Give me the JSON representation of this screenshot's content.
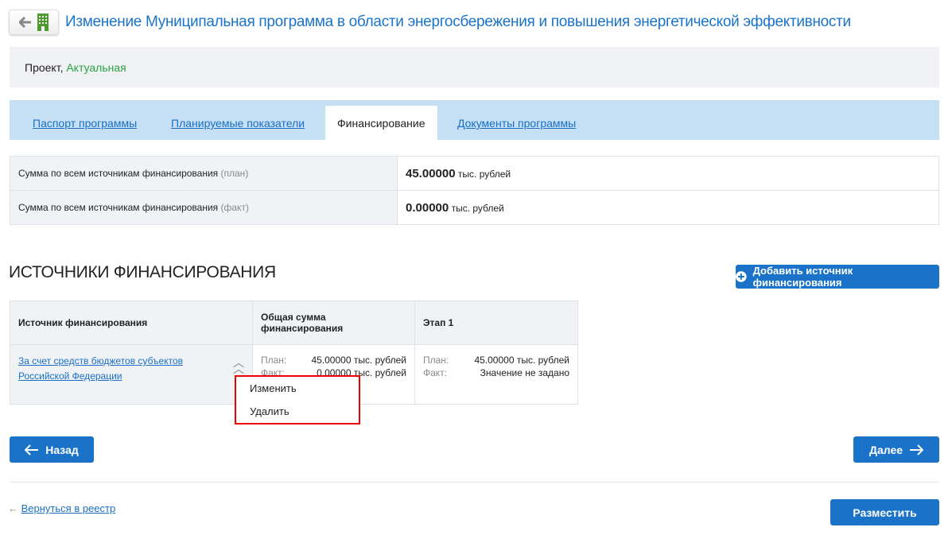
{
  "header": {
    "title": "Изменение Муниципальная программа в области энергосбережения и повышения энергетической эффективности"
  },
  "status": {
    "prefix": "Проект,",
    "state": "Актуальная"
  },
  "tabs": [
    {
      "label": "Паспорт программы"
    },
    {
      "label": "Планируемые показатели"
    },
    {
      "label": "Финансирование"
    },
    {
      "label": "Документы программы"
    }
  ],
  "summary": [
    {
      "label": "Сумма по всем источникам финансирования",
      "qualifier": "(план)",
      "value": "45.00000",
      "unit": "тыс. рублей"
    },
    {
      "label": "Сумма по всем источникам финансирования",
      "qualifier": "(факт)",
      "value": "0.00000",
      "unit": "тыс. рублей"
    }
  ],
  "sources": {
    "heading": "ИСТОЧНИКИ ФИНАНСИРОВАНИЯ",
    "add_label": "Добавить источник финансирования",
    "columns": [
      "Источник финансирования",
      "Общая сумма финансирования",
      "Этап 1"
    ],
    "row": {
      "source": "За счет средств бюджетов субъектов Российской Федерации",
      "total": {
        "plan_label": "План:",
        "plan": "45.00000 тыс. рублей",
        "fact_label": "Факт:",
        "fact": "0.00000 тыс. рублей"
      },
      "stage1": {
        "plan_label": "План:",
        "plan": "45.00000 тыс. рублей",
        "fact_label": "Факт:",
        "fact": "Значение не задано"
      }
    }
  },
  "menu": {
    "edit": "Изменить",
    "delete": "Удалить"
  },
  "nav": {
    "back": "Назад",
    "next": "Далее",
    "registry": "Вернуться в реестр",
    "publish": "Разместить"
  }
}
